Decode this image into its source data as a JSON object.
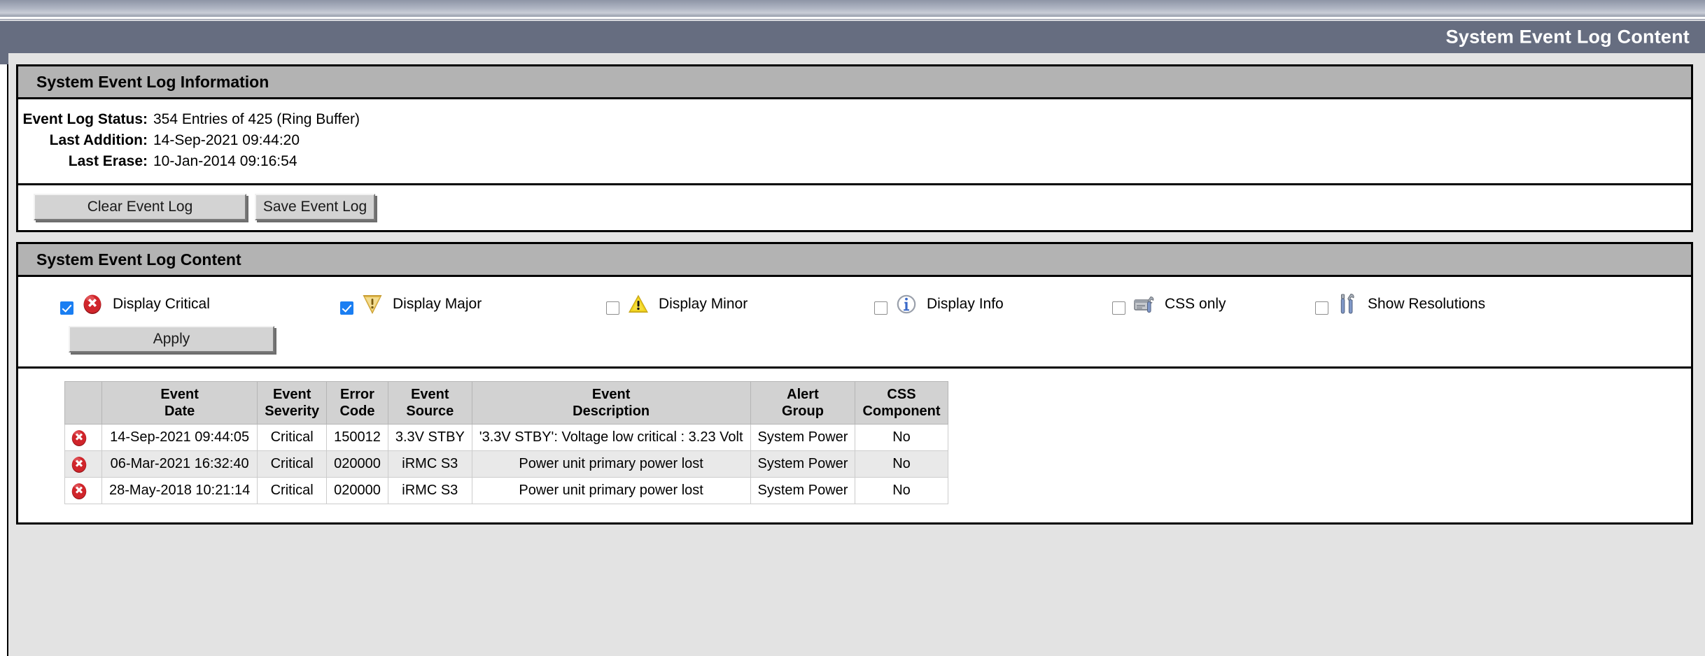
{
  "header": {
    "title": "System Event Log Content"
  },
  "info_panel": {
    "heading": "System Event Log Information",
    "rows": [
      {
        "label": "Event Log Status:",
        "value": "354 Entries of 425 (Ring Buffer)"
      },
      {
        "label": "Last Addition:",
        "value": "14-Sep-2021 09:44:20"
      },
      {
        "label": "Last Erase:",
        "value": "10-Jan-2014 09:16:54"
      }
    ],
    "buttons": {
      "clear": "Clear Event Log",
      "save": "Save Event Log"
    }
  },
  "content_panel": {
    "heading": "System Event Log Content",
    "filters": [
      {
        "label": "Display Critical",
        "icon": "critical-error-icon",
        "checked": true
      },
      {
        "label": "Display Major",
        "icon": "major-warning-icon",
        "checked": true
      },
      {
        "label": "Display Minor",
        "icon": "minor-warning-icon",
        "checked": false
      },
      {
        "label": "Display Info",
        "icon": "info-icon",
        "checked": false
      },
      {
        "label": "CSS only",
        "icon": "css-toolbox-icon",
        "checked": false
      },
      {
        "label": "Show Resolutions",
        "icon": "tools-icon",
        "checked": false
      }
    ],
    "apply_label": "Apply",
    "table": {
      "columns": [
        "",
        "Event\nDate",
        "Event\nSeverity",
        "Error\nCode",
        "Event\nSource",
        "Event\nDescription",
        "Alert\nGroup",
        "CSS\nComponent"
      ],
      "rows": [
        {
          "icon": "critical-error-icon",
          "event_date": "14-Sep-2021 09:44:05",
          "event_severity": "Critical",
          "error_code": "150012",
          "event_source": "3.3V STBY",
          "event_description": "'3.3V STBY': Voltage low critical : 3.23 Volt",
          "alert_group": "System Power",
          "css_component": "No"
        },
        {
          "icon": "critical-error-icon",
          "event_date": "06-Mar-2021 16:32:40",
          "event_severity": "Critical",
          "error_code": "020000",
          "event_source": "iRMC S3",
          "event_description": "Power unit primary power lost",
          "alert_group": "System Power",
          "css_component": "No"
        },
        {
          "icon": "critical-error-icon",
          "event_date": "28-May-2018 10:21:14",
          "event_severity": "Critical",
          "error_code": "020000",
          "event_source": "iRMC S3",
          "event_description": "Power unit primary power lost",
          "alert_group": "System Power",
          "css_component": "No"
        }
      ]
    }
  },
  "colors": {
    "title_bar": "#666d80",
    "panel_header": "#b3b3b3",
    "page_background": "#e3e3e3",
    "table_header": "#d2d2d2",
    "row_alt": "#e9e9e9",
    "checkbox_checked": "#1a7ef2",
    "critical_red": "#d0252b",
    "major_gold": "#e8bb4a",
    "minor_yellow": "#f2d41a",
    "info_blue": "#3a69c8"
  }
}
